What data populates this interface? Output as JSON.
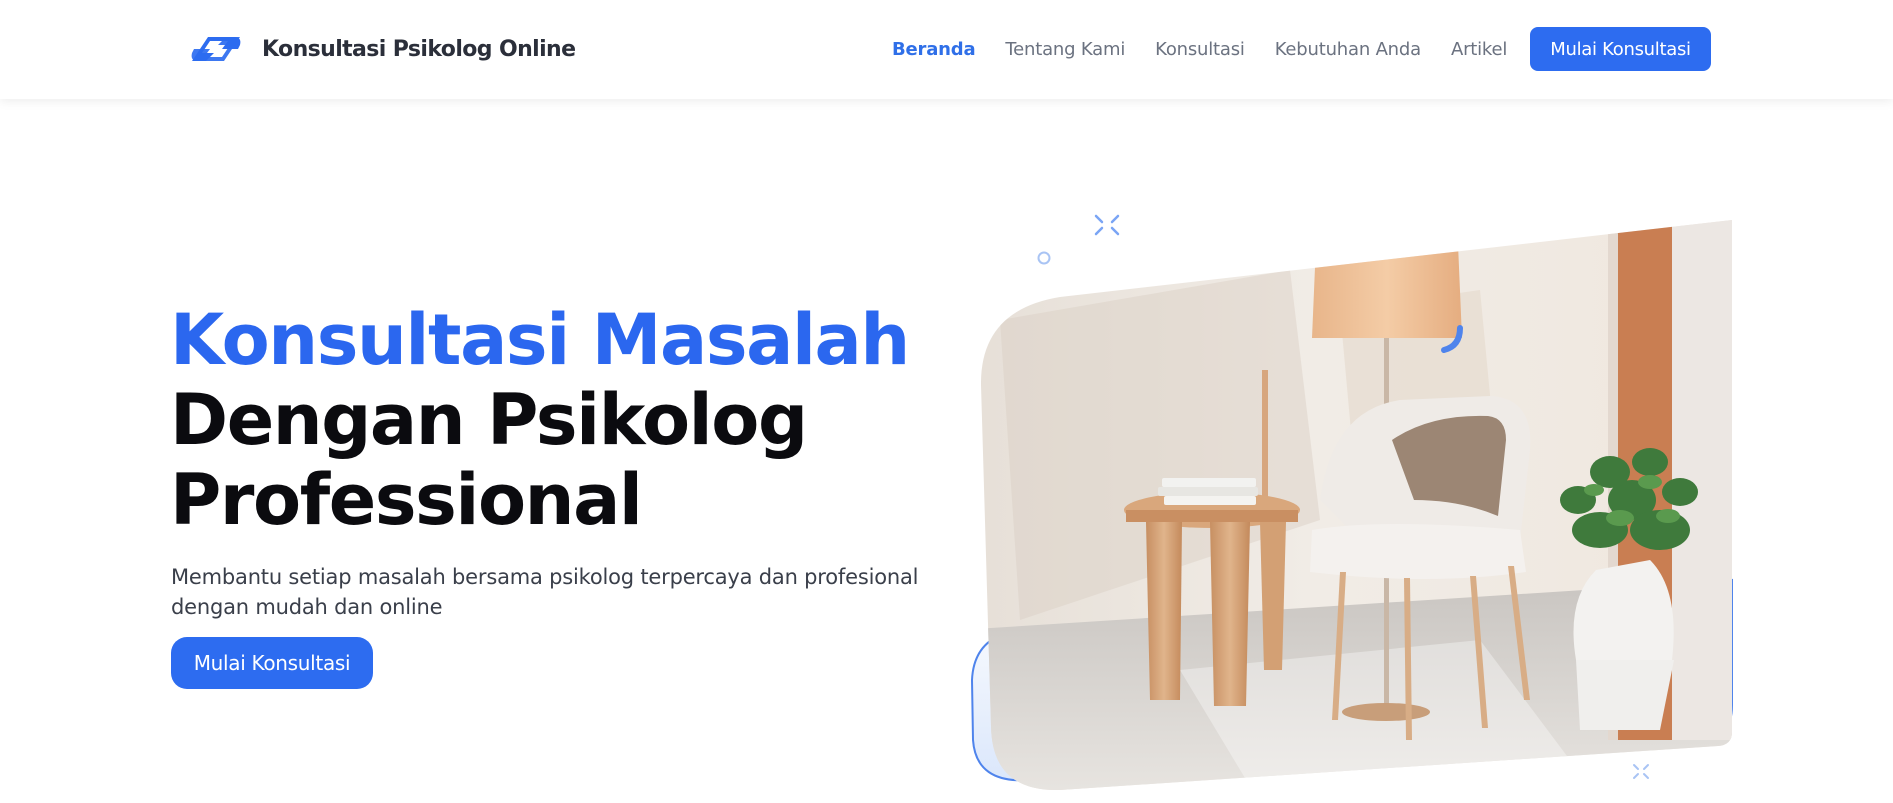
{
  "brand": {
    "name": "Konsultasi Psikolog Online",
    "logo_icon": "swirl-logo-icon"
  },
  "nav": {
    "items": [
      {
        "label": "Beranda",
        "active": true
      },
      {
        "label": "Tentang Kami",
        "active": false
      },
      {
        "label": "Konsultasi",
        "active": false
      },
      {
        "label": "Kebutuhan Anda",
        "active": false
      },
      {
        "label": "Artikel",
        "active": false
      }
    ],
    "cta_label": "Mulai Konsultasi"
  },
  "hero": {
    "title_line1": "Konsultasi Masalah",
    "title_line2": "Dengan Psikolog",
    "title_line3": "Professional",
    "subtitle": "Membantu setiap masalah bersama psikolog terpercaya dan profesional dengan mudah dan online",
    "cta_label": "Mulai Konsultasi",
    "image_icon": "room-with-chair-lamp-plant-image"
  },
  "colors": {
    "accent": "#2d6cf0",
    "title_accent": "#2b67ef",
    "nav_active": "#2f6fe8",
    "text_dark": "#0b0b0f",
    "text_muted": "#6b7280"
  }
}
